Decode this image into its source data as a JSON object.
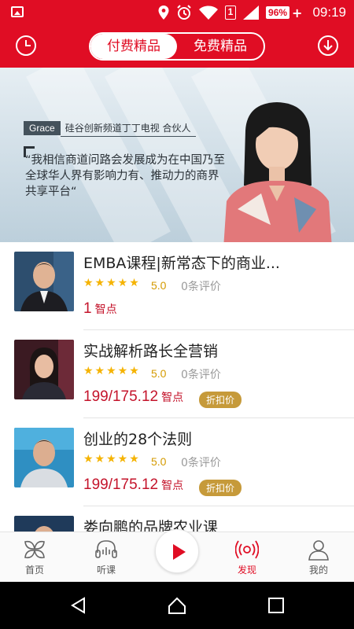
{
  "status_bar": {
    "sim_slot": "1",
    "battery": "96%",
    "time": "09:19"
  },
  "header": {
    "tabs": [
      {
        "label": "付费精品",
        "active": true
      },
      {
        "label": "免费精品",
        "active": false
      }
    ],
    "left_icon": "history-clock-icon",
    "right_icon": "download-icon"
  },
  "banner": {
    "name": "Grace",
    "role": "硅谷创新频道丁丁电视 合伙人",
    "quote": "“我相信商道问路会发展成为在中国乃至全球华人界有影响力有、推动力的商界共享平台“"
  },
  "courses": [
    {
      "title": "EMBA课程|新常态下的商业...",
      "stars": "★★★★★",
      "score": "5.0",
      "reviews": "0条评价",
      "price": "1",
      "unit": "智点",
      "discount": ""
    },
    {
      "title": "实战解析路长全营销",
      "stars": "★★★★★",
      "score": "5.0",
      "reviews": "0条评价",
      "price": "199/175.12",
      "unit": "智点",
      "discount": "折扣价"
    },
    {
      "title": "创业的28个法则",
      "stars": "★★★★★",
      "score": "5.0",
      "reviews": "0条评价",
      "price": "199/175.12",
      "unit": "智点",
      "discount": "折扣价"
    },
    {
      "title": "娄向鹏的品牌农业课",
      "stars": "",
      "score": "",
      "reviews": "",
      "price": "",
      "unit": "",
      "discount": ""
    }
  ],
  "tabbar": {
    "items": [
      {
        "label": "首页",
        "icon": "home-grid-icon",
        "active": false
      },
      {
        "label": "听课",
        "icon": "headphones-icon",
        "active": false
      },
      {
        "label": "发现",
        "icon": "discover-signal-icon",
        "active": true
      },
      {
        "label": "我的",
        "icon": "profile-icon",
        "active": false
      }
    ],
    "center_icon": "play-icon"
  },
  "colors": {
    "brand_red": "#e00d24",
    "price_red": "#c4142b",
    "star_gold": "#f5b300",
    "discount_gold": "#c69a3a"
  }
}
